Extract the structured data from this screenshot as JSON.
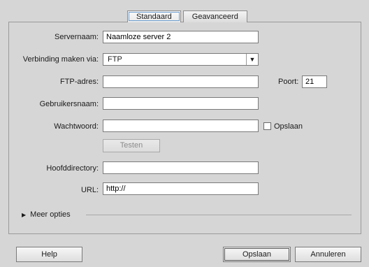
{
  "tabs": {
    "basic": "Standaard",
    "advanced": "Geavanceerd"
  },
  "fields": {
    "server_name": {
      "label": "Servernaam:",
      "value": "Naamloze server 2"
    },
    "connect_via": {
      "label": "Verbinding maken via:",
      "value": "FTP"
    },
    "ftp_address": {
      "label": "FTP-adres:",
      "value": ""
    },
    "port": {
      "label": "Poort:",
      "value": "21"
    },
    "username": {
      "label": "Gebruikersnaam:",
      "value": ""
    },
    "password": {
      "label": "Wachtwoord:",
      "value": ""
    },
    "save_password": {
      "label": "Opslaan",
      "checked": false
    },
    "root_directory": {
      "label": "Hoofddirectory:",
      "value": ""
    },
    "url": {
      "label": "URL:",
      "value": "http://"
    }
  },
  "test_button": "Testen",
  "more_options": "Meer opties",
  "footer": {
    "help": "Help",
    "save": "Opslaan",
    "cancel": "Annuleren"
  }
}
